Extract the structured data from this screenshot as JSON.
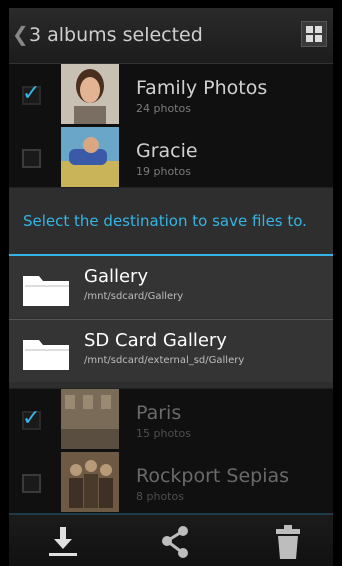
{
  "action_bar": {
    "title": "3 albums selected",
    "back_icon": "chevron-left-icon",
    "grid_icon": "grid-icon"
  },
  "albums": [
    {
      "name": "Family Photos",
      "count": "24 photos",
      "checked": true
    },
    {
      "name": "Gracie",
      "count": "19 photos",
      "checked": false
    },
    {
      "name": "Paris",
      "count": "15 photos",
      "checked": true
    },
    {
      "name": "Rockport Sepias",
      "count": "8 photos",
      "checked": false
    }
  ],
  "dialog": {
    "title": "Select the destination to save files to.",
    "destinations": [
      {
        "name": "Gallery",
        "path": "/mnt/sdcard/Gallery"
      },
      {
        "name": "SD Card Gallery",
        "path": "/mnt/sdcard/external_sd/Gallery"
      }
    ]
  },
  "toolbar": {
    "items": [
      "download-icon",
      "share-icon",
      "trash-icon"
    ]
  },
  "colors": {
    "accent": "#33b5e5",
    "background": "#101010",
    "dialog": "#2e2e2e"
  }
}
